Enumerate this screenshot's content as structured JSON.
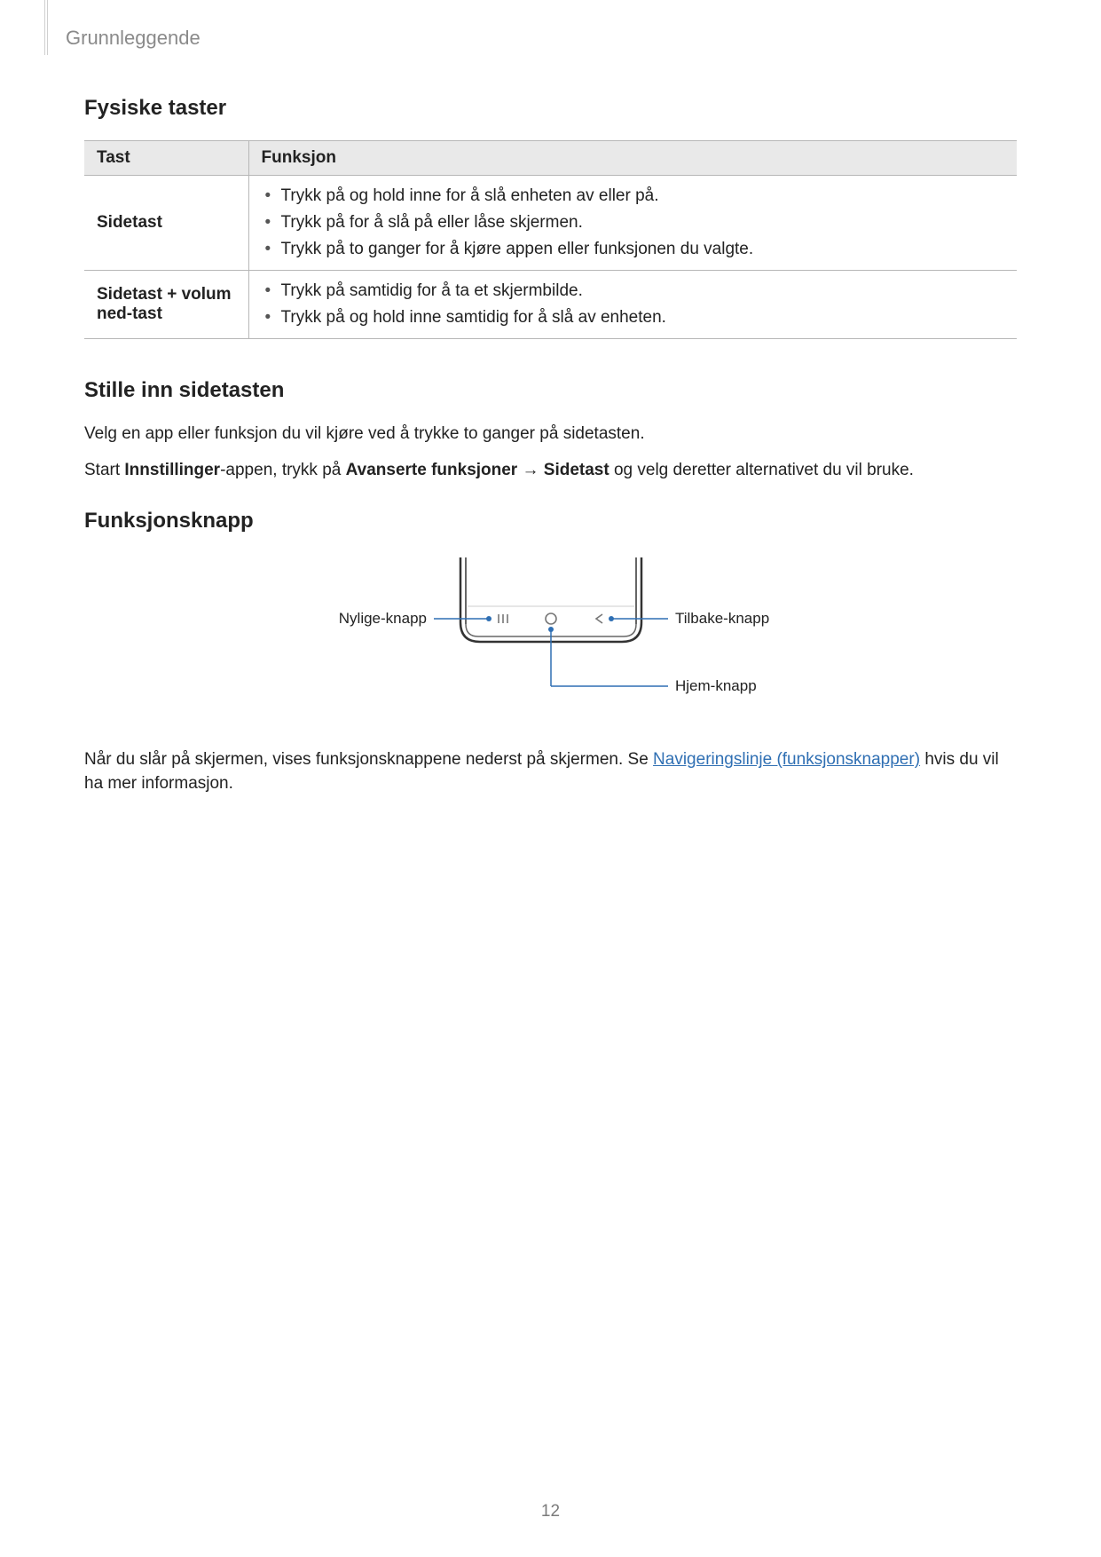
{
  "header": {
    "breadcrumb": "Grunnleggende"
  },
  "section1": {
    "heading": "Fysiske taster",
    "table": {
      "col1": "Tast",
      "col2": "Funksjon",
      "row1": {
        "key": "Sidetast",
        "items": [
          "Trykk på og hold inne for å slå enheten av eller på.",
          "Trykk på for å slå på eller låse skjermen.",
          "Trykk på to ganger for å kjøre appen eller funksjonen du valgte."
        ]
      },
      "row2": {
        "key": "Sidetast + volum ned-tast",
        "items": [
          "Trykk på samtidig for å ta et skjermbilde.",
          "Trykk på og hold inne samtidig for å slå av enheten."
        ]
      }
    }
  },
  "section2": {
    "heading": "Stille inn sidetasten",
    "para1": "Velg en app eller funksjon du vil kjøre ved å trykke to ganger på sidetasten.",
    "para2_a": "Start ",
    "para2_b_bold": "Innstillinger",
    "para2_c": "-appen, trykk på ",
    "para2_d_bold": "Avanserte funksjoner",
    "para2_arrow": " → ",
    "para2_e_bold": "Sidetast",
    "para2_f": " og velg deretter alternativet du vil bruke."
  },
  "section3": {
    "heading": "Funksjonsknapp",
    "labels": {
      "recent": "Nylige-knapp",
      "back": "Tilbake-knapp",
      "home": "Hjem-knapp"
    },
    "para_a": "Når du slår på skjermen, vises funksjonsknappene nederst på skjermen. Se ",
    "para_link": "Navigeringslinje (funksjonsknapper)",
    "para_b": " hvis du vil ha mer informasjon."
  },
  "page_number": "12"
}
